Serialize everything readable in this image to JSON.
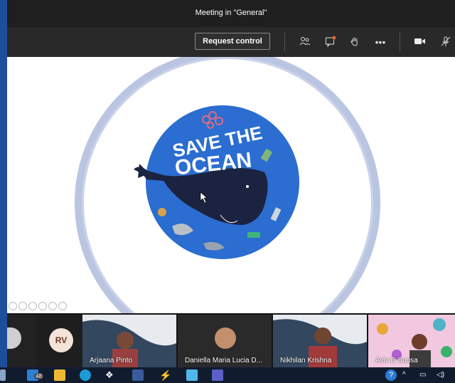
{
  "window": {
    "title": "Meeting in \"General\""
  },
  "toolbar": {
    "request_control_label": "Request control",
    "icons": [
      "people-icon",
      "chat-icon",
      "raise-hand-icon",
      "more-icon",
      "camera-icon",
      "mic-off-icon"
    ]
  },
  "shared_content": {
    "headline_line1": "SAVE THE",
    "headline_line2": "OCEAN"
  },
  "participants": [
    {
      "initials": "RV"
    },
    {
      "name": "Arjaana Pinto"
    },
    {
      "name": "Daniella Maria Lucia D..."
    },
    {
      "name": "Nikhilan Krishna"
    },
    {
      "name": "Aviv D Sousa"
    }
  ],
  "taskbar": {
    "badge_count": "48"
  },
  "colors": {
    "brand_blue": "#1d4e9e",
    "ocean_blue": "#2b6dd0",
    "whale": "#1b2340"
  }
}
